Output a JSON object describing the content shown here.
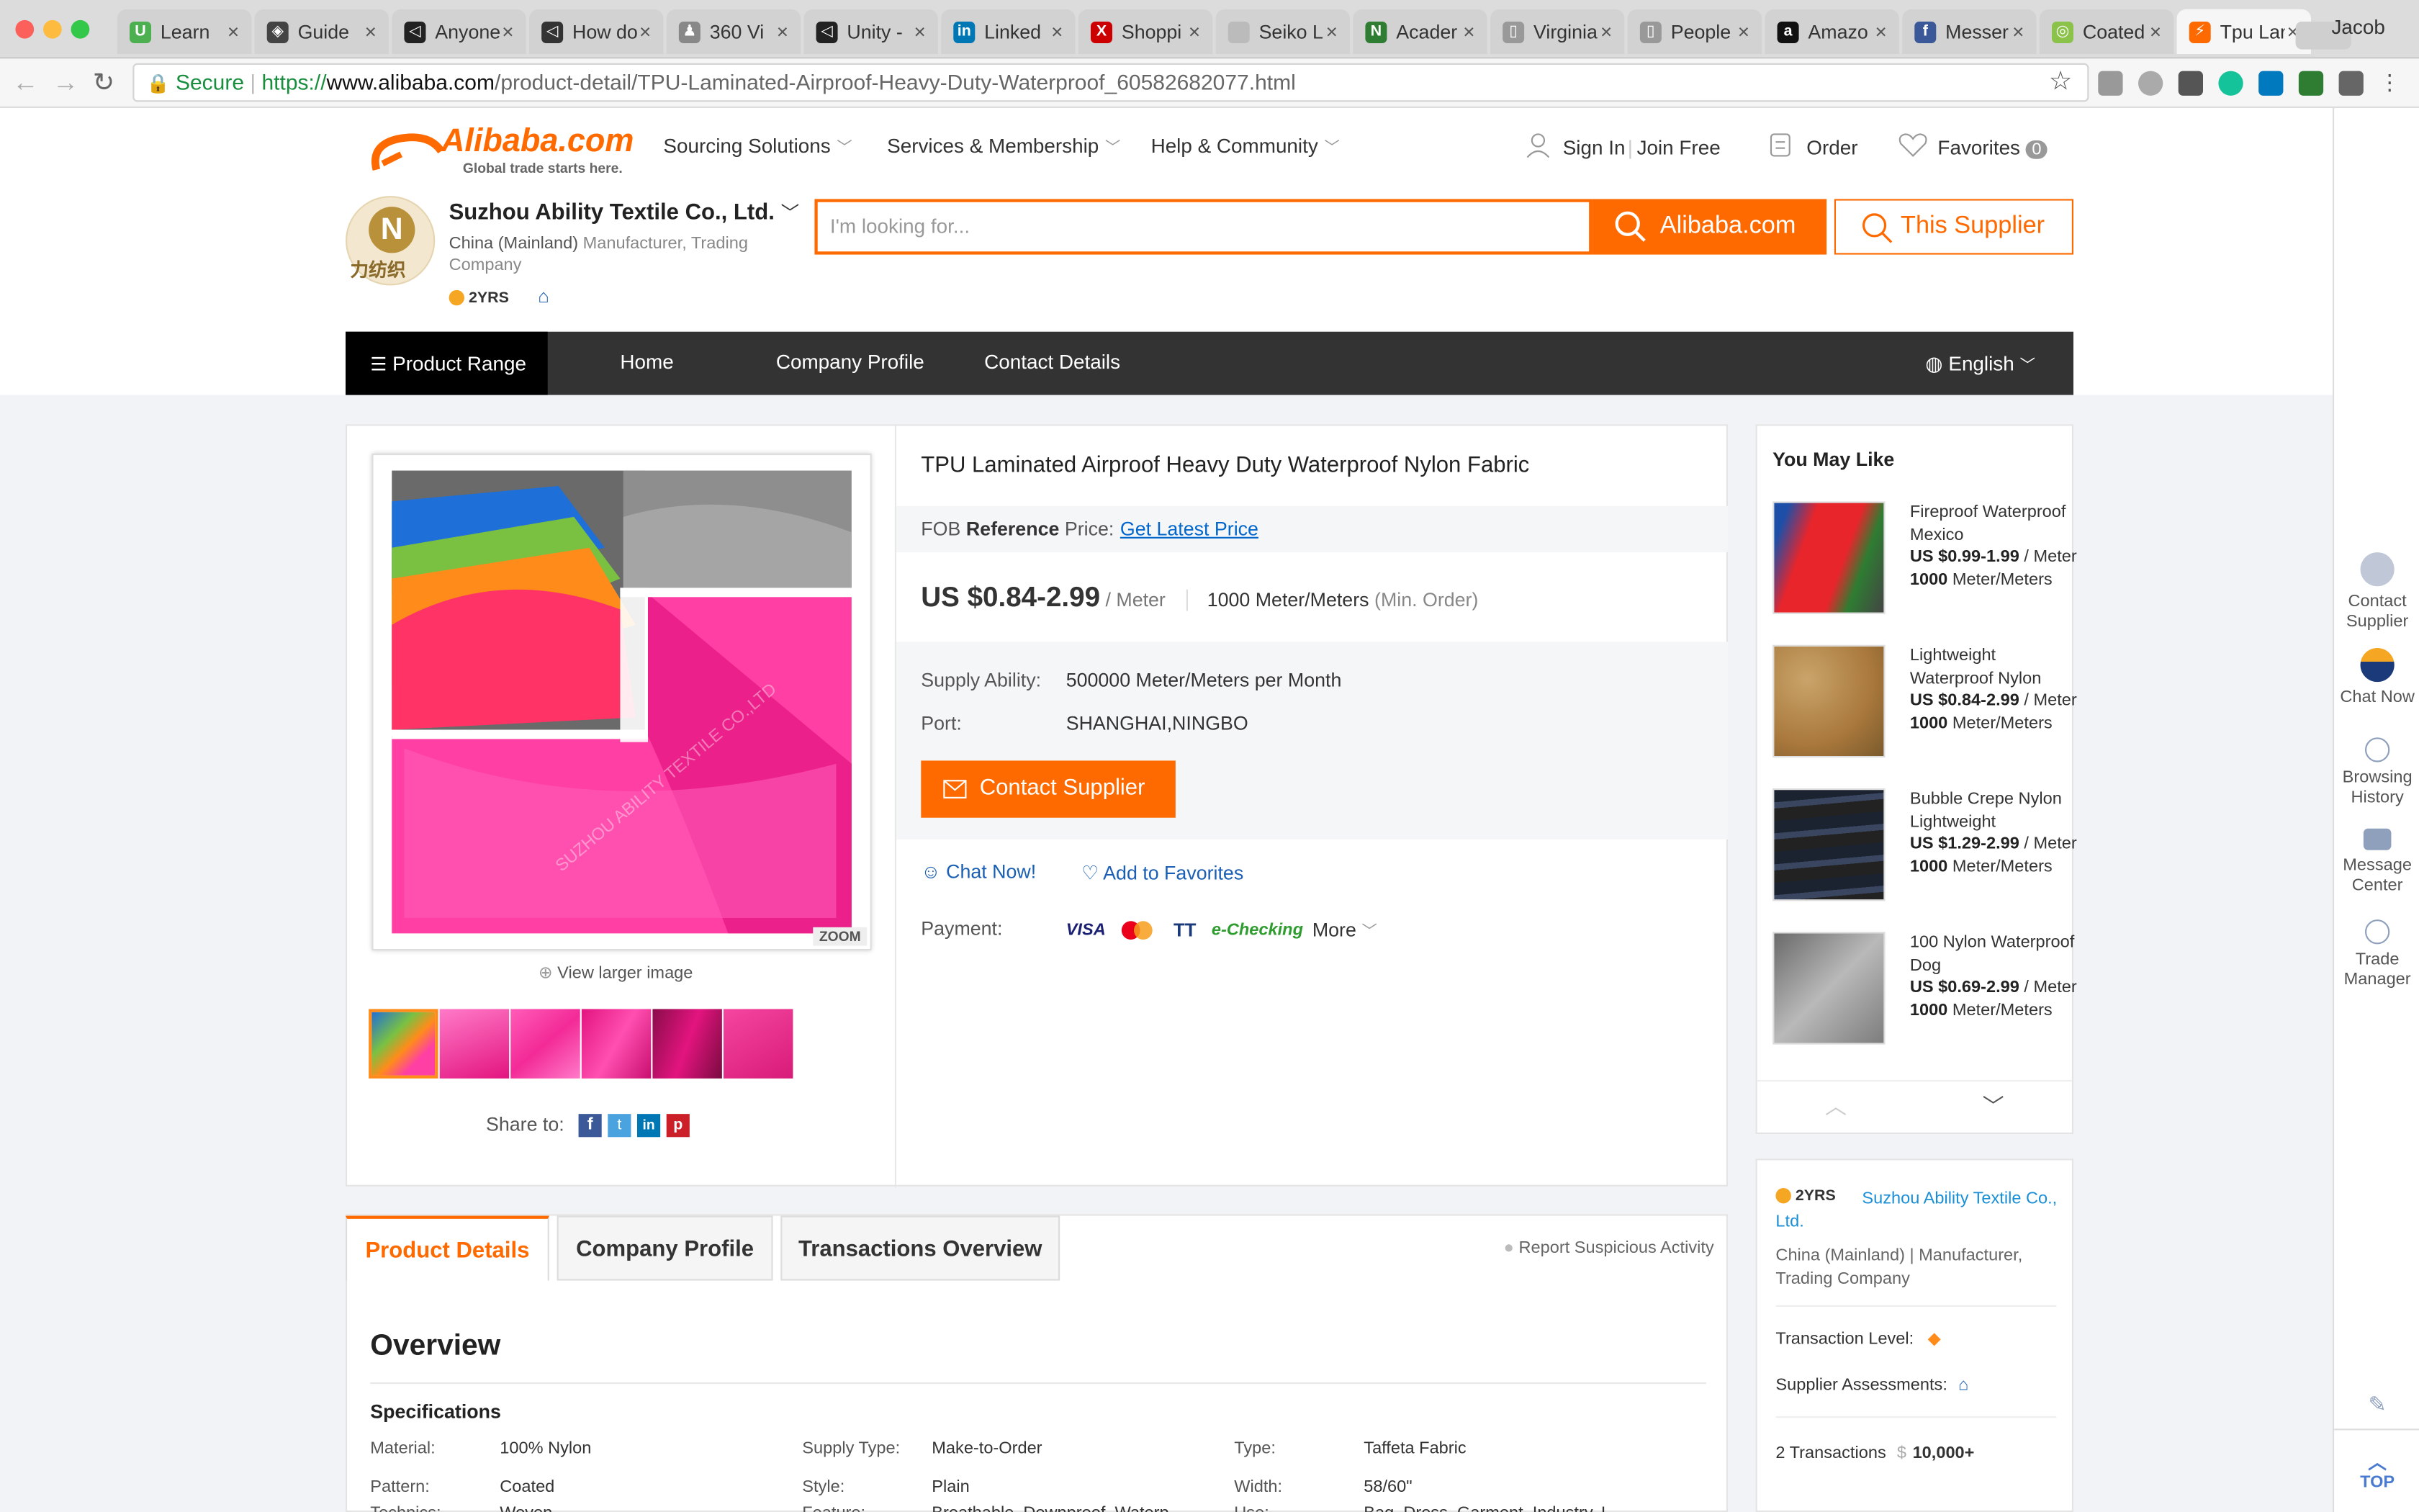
{
  "browser": {
    "profile": "Jacob",
    "tabs": [
      {
        "title": "Learn",
        "color": "#4caf50",
        "glyph": "U"
      },
      {
        "title": "Guide",
        "color": "#444",
        "glyph": "◈"
      },
      {
        "title": "Anyone",
        "color": "#222",
        "glyph": "◁"
      },
      {
        "title": "How do",
        "color": "#333",
        "glyph": "◁"
      },
      {
        "title": "360 Vi",
        "color": "#888",
        "glyph": "♟"
      },
      {
        "title": "Unity -",
        "color": "#222",
        "glyph": "◁"
      },
      {
        "title": "Linked",
        "color": "#0077b5",
        "glyph": "in"
      },
      {
        "title": "Shoppi",
        "color": "#c00",
        "glyph": "X"
      },
      {
        "title": "Seiko L",
        "color": "#bbb",
        "glyph": ""
      },
      {
        "title": "Acader",
        "color": "#2e7d32",
        "glyph": "N"
      },
      {
        "title": "Virginia",
        "color": "#999",
        "glyph": "▯"
      },
      {
        "title": "People",
        "color": "#999",
        "glyph": "▯"
      },
      {
        "title": "Amazo",
        "color": "#111",
        "glyph": "a"
      },
      {
        "title": "Messer",
        "color": "#3b5998",
        "glyph": "f"
      },
      {
        "title": "Coated",
        "color": "#8bc34a",
        "glyph": "◎"
      },
      {
        "title": "Tpu Lar",
        "color": "#ff6a00",
        "glyph": "⚡",
        "active": true
      }
    ],
    "secure": "Secure",
    "url_scheme": "https://",
    "url_host": "www.alibaba.com",
    "url_path": "/product-detail/TPU-Laminated-Airproof-Heavy-Duty-Waterproof_60582682077.html"
  },
  "header": {
    "logo_text": "Alibaba.com",
    "logo_tagline": "Global trade starts here.",
    "nav": [
      "Sourcing Solutions",
      "Services & Membership",
      "Help & Community"
    ],
    "sign_in": "Sign In",
    "join": "Join Free",
    "order": "Order",
    "favorites": "Favorites",
    "fav_count": "0"
  },
  "supplier": {
    "name": "Suzhou Ability Textile Co., Ltd.",
    "region": "China (Mainland)",
    "type": "Manufacturer, Trading Company",
    "years": "2YRS",
    "logo_text": "力纺织"
  },
  "search": {
    "placeholder": "I'm looking for...",
    "btn_alibaba": "Alibaba.com",
    "btn_supplier": "This Supplier"
  },
  "storenav": {
    "product_range": "Product Range",
    "home": "Home",
    "company_profile": "Company Profile",
    "contact": "Contact Details",
    "language": "English"
  },
  "gallery": {
    "zoom": "ZOOM",
    "view_larger": "View larger image",
    "share": "Share to:",
    "watermark": "SUZHOU ABILITY TEXTILE CO.,LTD"
  },
  "product": {
    "title": "TPU Laminated Airproof Heavy Duty Waterproof Nylon Fabric",
    "fob_label": "FOB",
    "fob_ref": "Reference",
    "fob_price": "Price:",
    "fob_link": "Get Latest Price",
    "price": "US $0.84-2.99",
    "unit": "/ Meter",
    "moq": "1000 Meter/Meters",
    "moq_note": "(Min. Order)",
    "supply_label": "Supply Ability:",
    "supply_value": "500000 Meter/Meters per Month",
    "port_label": "Port:",
    "port_value": "SHANGHAI,NINGBO",
    "contact_btn": "Contact Supplier",
    "chat_now": "Chat Now!",
    "add_fav": "Add to Favorites",
    "payment_label": "Payment:",
    "payments": [
      "VISA",
      "MC",
      "TT",
      "e-Checking"
    ],
    "more": "More"
  },
  "details": {
    "tabs": [
      "Product Details",
      "Company Profile",
      "Transactions Overview"
    ],
    "report": "Report Suspicious Activity",
    "overview": "Overview",
    "specs_title": "Specifications",
    "specs": [
      {
        "label": "Material:",
        "value": "100% Nylon"
      },
      {
        "label": "Supply Type:",
        "value": "Make-to-Order"
      },
      {
        "label": "Type:",
        "value": "Taffeta Fabric"
      },
      {
        "label": "Pattern:",
        "value": "Coated"
      },
      {
        "label": "Style:",
        "value": "Plain"
      },
      {
        "label": "Width:",
        "value": "58/60\""
      },
      {
        "label": "Technics:",
        "value": "Woven"
      },
      {
        "label": "Feature:",
        "value": "Breathable, Downproof, Waterp"
      },
      {
        "label": "Use:",
        "value": "Bag, Dress, Garment, Industry, L"
      }
    ]
  },
  "you_may_like": {
    "title": "You May Like",
    "items": [
      {
        "name": "Fireproof Waterproof Mexico",
        "price": "US $0.99-1.99",
        "unit": " / Meter",
        "moq": "1000",
        "moq_unit": " Meter/Meters"
      },
      {
        "name": "Lightweight Waterproof Nylon",
        "price": "US $0.84-2.99",
        "unit": " / Meter",
        "moq": "1000",
        "moq_unit": " Meter/Meters"
      },
      {
        "name": "Bubble Crepe Nylon Lightweight",
        "price": "US $1.29-2.99",
        "unit": " / Meter",
        "moq": "1000",
        "moq_unit": " Meter/Meters"
      },
      {
        "name": "100 Nylon Waterproof Dog",
        "price": "US $0.69-2.99",
        "unit": " / Meter",
        "moq": "1000",
        "moq_unit": " Meter/Meters"
      }
    ]
  },
  "supplier_card": {
    "years": "2YRS",
    "name": "Suzhou Ability Textile Co., Ltd.",
    "meta": "China (Mainland) | Manufacturer, Trading Company",
    "transaction_level": "Transaction Level:",
    "assessments": "Supplier Assessments:",
    "transactions": "2 Transactions",
    "amount": "10,000+"
  },
  "rail": {
    "contact": "Contact Supplier",
    "chat": "Chat Now",
    "history": "Browsing History",
    "message": "Message Center",
    "trade": "Trade Manager",
    "top": "TOP"
  }
}
